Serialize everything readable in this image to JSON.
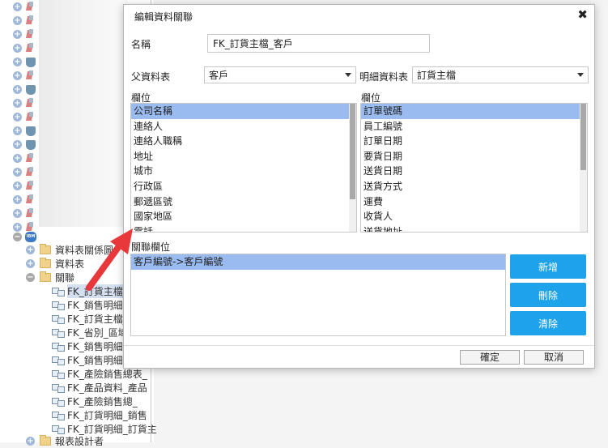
{
  "tree": {
    "datasets_folder": "資料表關係圖(",
    "tables_folder": "資料表",
    "relations_folder": "關聯",
    "relations": [
      "FK_訂貨主檔_",
      "FK_銷售明細",
      "FK_訂貨主檔_",
      "FK_省別_區域",
      "FK_銷售明細",
      "FK_銷售明細",
      "FK_產險銷售總表_",
      "FK_產品資料_產品",
      "FK_產險銷售總_",
      "FK_訂貨明細_銷售",
      "FK_訂貨明細_訂貨主"
    ],
    "report_folder": "報表設計者",
    "db_badge": "IBM"
  },
  "dialog": {
    "title": "編輯資料關聯",
    "close_glyph": "✖",
    "name_label": "名稱",
    "name_value": "FK_訂貨主檔_客戶",
    "parent_label": "父資料表",
    "parent_value": "客戶",
    "detail_label": "明細資料表",
    "detail_value": "訂貨主檔",
    "parent_fields_label": "欄位",
    "detail_fields_label": "欄位",
    "parent_fields": [
      "公司名稱",
      "連絡人",
      "連絡人職稱",
      "地址",
      "城市",
      "行政區",
      "郵遞區號",
      "國家地區",
      "電話"
    ],
    "detail_fields": [
      "訂單號碼",
      "員工編號",
      "訂單日期",
      "要貨日期",
      "送貨日期",
      "送貨方式",
      "運費",
      "收貨人",
      "送貨地址"
    ],
    "relation_fields_label": "關聯欄位",
    "relation_fields": [
      "客戶編號->客戶編號"
    ],
    "add_button": "新增",
    "delete_button": "刪除",
    "clear_button": "清除",
    "ok_button": "確定",
    "cancel_button": "取消"
  },
  "colors": {
    "accent_button": "#1ea3eb",
    "selection": "#99bbf0",
    "arrow": "#e8383c"
  }
}
